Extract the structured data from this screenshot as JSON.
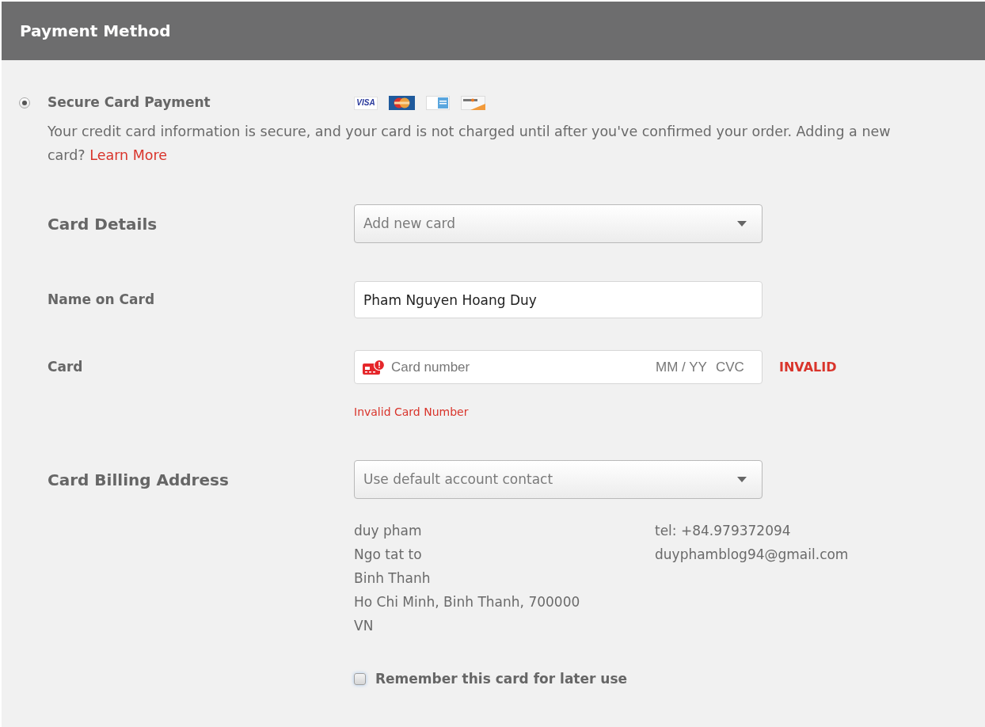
{
  "header": {
    "title": "Payment Method"
  },
  "payment_option": {
    "selected": true,
    "label": "Secure Card Payment",
    "card_logos": [
      {
        "kind": "visa",
        "text": "VISA"
      },
      {
        "kind": "mastercard"
      },
      {
        "kind": "amex"
      },
      {
        "kind": "discover"
      }
    ],
    "description": "Your credit card information is secure, and your card is not charged until after you've confirmed your order. Adding a new card?",
    "link": "Learn More"
  },
  "form": {
    "rows": [
      {
        "kind": "select",
        "label": "Card Details",
        "value": "Add new card"
      },
      {
        "kind": "text",
        "label": "Name on Card",
        "value": "Pham Nguyen Hoang Duy"
      },
      {
        "kind": "card",
        "label": "Card",
        "placeholder": "Card number",
        "expiry_placeholder": "MM / YY",
        "cvc_placeholder": "CVC",
        "status": "INVALID",
        "error": "Invalid Card Number"
      },
      {
        "kind": "select",
        "label": "Card Billing Address",
        "value": "Use default account contact"
      }
    ]
  },
  "address": {
    "lines": [
      "duy pham",
      "Ngo tat to",
      "Binh Thanh",
      "Ho Chi Minh, Binh Thanh, 700000",
      "VN"
    ],
    "contact": [
      "tel: +84.979372094",
      "duyphamblog94@gmail.com"
    ]
  },
  "remember": {
    "label": "Remember this card for later use",
    "checked": false
  }
}
